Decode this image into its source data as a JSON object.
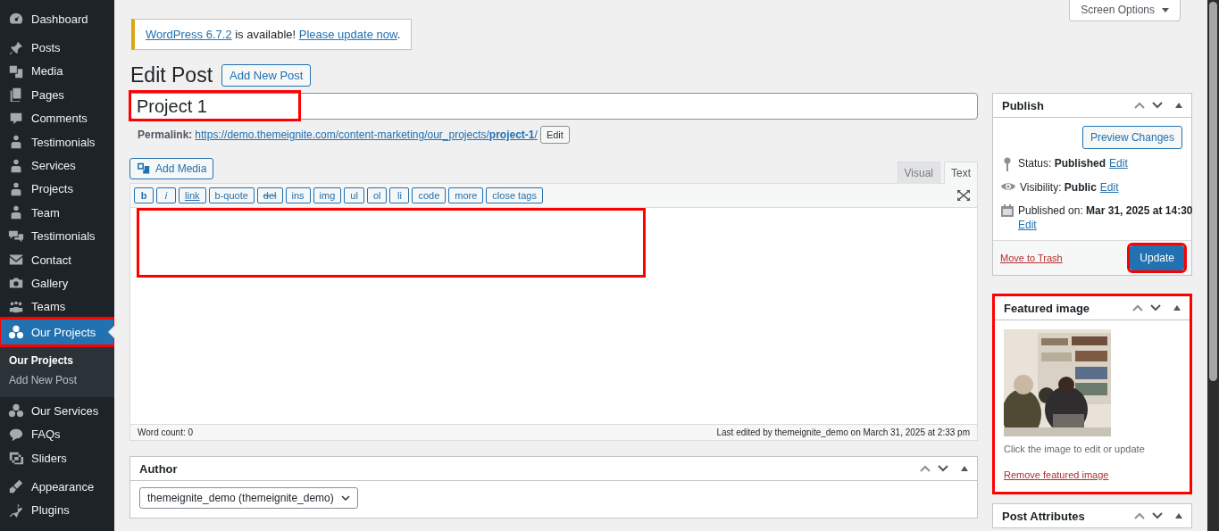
{
  "sidebar": {
    "groups": [
      [
        {
          "label": "Dashboard",
          "selected": false
        }
      ],
      [
        {
          "label": "Posts",
          "selected": false
        },
        {
          "label": "Media",
          "selected": false
        },
        {
          "label": "Pages",
          "selected": false
        },
        {
          "label": "Comments",
          "selected": false
        },
        {
          "label": "Testimonials",
          "selected": false
        },
        {
          "label": "Services",
          "selected": false
        },
        {
          "label": "Projects",
          "selected": false
        },
        {
          "label": "Team",
          "selected": false
        },
        {
          "label": "Testimonials",
          "selected": false
        },
        {
          "label": "Contact",
          "selected": false
        },
        {
          "label": "Gallery",
          "selected": false
        },
        {
          "label": "Teams",
          "selected": false
        },
        {
          "label": "Our Projects",
          "selected": true,
          "highlighted": true,
          "children": [
            {
              "label": "Our Projects",
              "selected": true
            },
            {
              "label": "Add New Post",
              "selected": false
            }
          ]
        },
        {
          "label": "Our Services",
          "selected": false
        },
        {
          "label": "FAQs",
          "selected": false
        },
        {
          "label": "Sliders",
          "selected": false
        }
      ],
      [
        {
          "label": "Appearance",
          "selected": false
        },
        {
          "label": "Plugins",
          "selected": false
        }
      ]
    ]
  },
  "screen_options": "Screen Options",
  "notice": {
    "parts": [
      {
        "kind": "link",
        "text": "WordPress 6.7.2"
      },
      {
        "kind": "text",
        "text": " is available! "
      },
      {
        "kind": "link",
        "text": "Please update now"
      },
      {
        "kind": "text",
        "text": "."
      }
    ]
  },
  "heading": {
    "title": "Edit Post",
    "button": "Add New Post"
  },
  "title_field": {
    "value": "Project 1",
    "highlighted": true
  },
  "permalink": {
    "label": "Permalink:",
    "url": "https://demo.themeignite.com/content-marketing/our_projects/**project-1**/",
    "button": "Edit"
  },
  "editor": {
    "add_media": "Add Media",
    "tabs": [
      {
        "label": "Visual",
        "selected": false
      },
      {
        "label": "Text",
        "selected": true
      }
    ],
    "toolbar": [
      "b",
      "i",
      "link",
      "b-quote",
      "del",
      "ins",
      "img",
      "ul",
      "ol",
      "li",
      "code",
      "more",
      "close tags"
    ],
    "highlighted": true,
    "word_count": "Word count: 0",
    "last_edited": "Last edited by themeignite_demo on March 31, 2025 at 2:33 pm"
  },
  "author": {
    "title": "Author",
    "value": "themeignite_demo (themeignite_demo)"
  },
  "publish": {
    "title": "Publish",
    "preview": "Preview Changes",
    "rows": [
      {
        "text": "Status: **Published**",
        "link": "Edit"
      },
      {
        "text": "Visibility: **Public**",
        "link": "Edit"
      },
      {
        "text": "Published on: **Mar 31, 2025 at 14:30**",
        "link": "Edit"
      }
    ],
    "trash": "Move to Trash",
    "update": "Update",
    "update_highlighted": true
  },
  "featured": {
    "title": "Featured image",
    "highlighted": true,
    "caption": "Click the image to edit or update",
    "remove": "Remove featured image"
  },
  "attributes": {
    "title": "Post Attributes"
  }
}
